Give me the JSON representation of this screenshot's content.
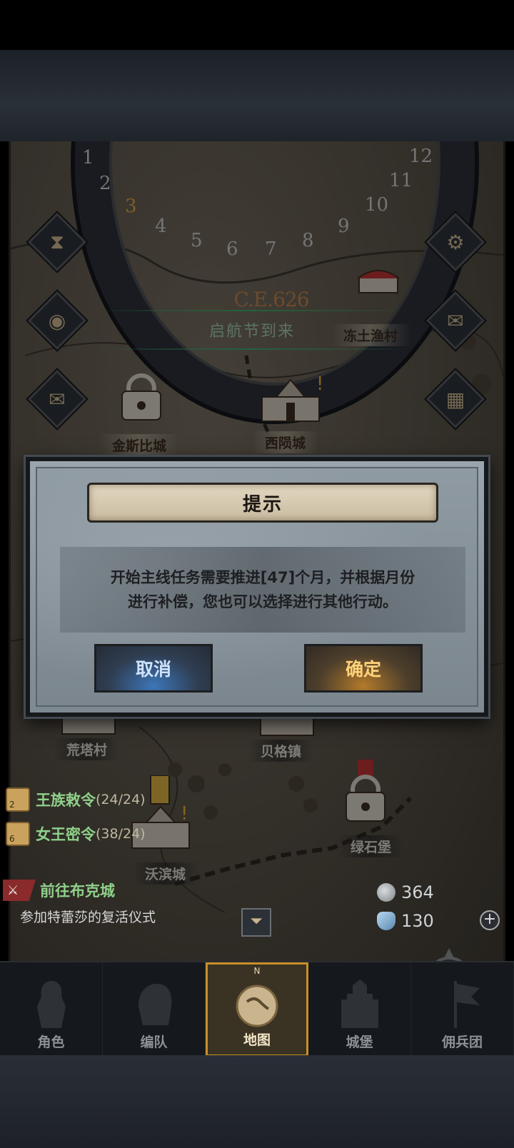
{
  "calendar": {
    "year": "C.E.626",
    "months": [
      "1",
      "2",
      "3",
      "4",
      "5",
      "6",
      "7",
      "8",
      "9",
      "10",
      "11",
      "12"
    ],
    "current_month": "3"
  },
  "event_banner": "启航节到来",
  "locations": {
    "frozen_village": "冻土渔村",
    "west_city": "西陨城",
    "golden_city_partial": "金斯比城",
    "tower_village": "荒塔村",
    "beige_town": "贝格镇",
    "green_fort": "绿石堡",
    "wobin_city": "沃滨城"
  },
  "quests": [
    {
      "name": "王族敕令",
      "progress": "(24/24)",
      "badge": "2"
    },
    {
      "name": "女王密令",
      "progress": "(38/24)",
      "badge": "6"
    }
  ],
  "main_quest": {
    "title": "前往布克城",
    "subtitle": "参加特蕾莎的复活仪式"
  },
  "resources": {
    "silver": "364",
    "crystal": "130"
  },
  "nav": {
    "compass_n": "N",
    "items": [
      "角色",
      "编队",
      "地图",
      "城堡",
      "佣兵团"
    ],
    "active": "地图"
  },
  "dialog": {
    "title": "提示",
    "message": "开始主线任务需要推进[47]个月，并根据月份\n进行补偿，您也可以选择进行其他行动。",
    "cancel_label": "取消",
    "confirm_label": "确定"
  },
  "colors": {
    "quest_green": "#8fd08a",
    "nav_active_border": "#c98f28",
    "cancel_blue": "#3d76b8",
    "confirm_gold": "#b37a2a"
  }
}
